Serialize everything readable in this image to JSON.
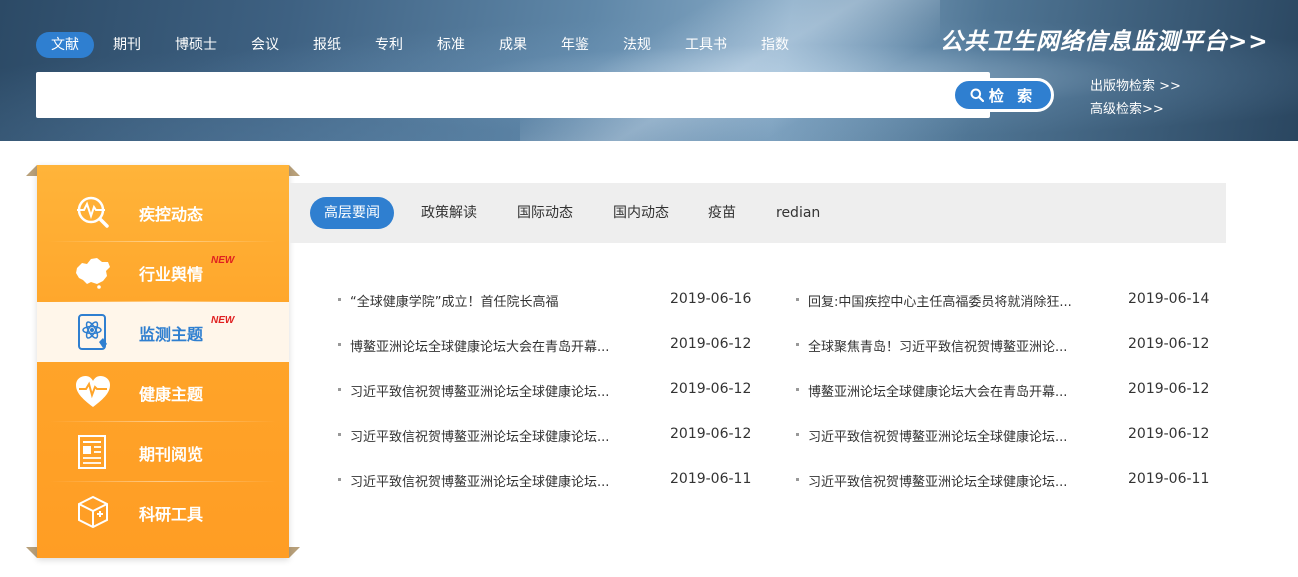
{
  "nav": {
    "items": [
      "文献",
      "期刊",
      "博硕士",
      "会议",
      "报纸",
      "专利",
      "标准",
      "成果",
      "年鉴",
      "法规",
      "工具书",
      "指数"
    ]
  },
  "search": {
    "placeholder": "",
    "value": "",
    "button_label": "检 索"
  },
  "platform_title": "公共卫生网络信息监测平台>>",
  "links": {
    "publication_search": "出版物检索 >>",
    "advanced_search": "高级检索>>"
  },
  "sidebar": {
    "items": [
      {
        "label": "疾控动态",
        "icon": "magnifier-heartbeat-icon",
        "badge": ""
      },
      {
        "label": "行业舆情",
        "icon": "china-map-icon",
        "badge": "NEW"
      },
      {
        "label": "监测主题",
        "icon": "tablet-atom-icon",
        "badge": "NEW"
      },
      {
        "label": "健康主题",
        "icon": "heart-pulse-icon",
        "badge": ""
      },
      {
        "label": "期刊阅览",
        "icon": "newspaper-icon",
        "badge": ""
      },
      {
        "label": "科研工具",
        "icon": "medical-box-icon",
        "badge": ""
      }
    ],
    "active_index": 2
  },
  "tabs": [
    "高层要闻",
    "政策解读",
    "国际动态",
    "国内动态",
    "疫苗",
    "redian"
  ],
  "active_tab": 0,
  "news_left": [
    {
      "title": "“全球健康学院”成立！首任院长高福",
      "date": "2019-06-16"
    },
    {
      "title": "博鳌亚洲论坛全球健康论坛大会在青岛开幕...",
      "date": "2019-06-12"
    },
    {
      "title": "习近平致信祝贺博鳌亚洲论坛全球健康论坛...",
      "date": "2019-06-12"
    },
    {
      "title": "习近平致信祝贺博鳌亚洲论坛全球健康论坛...",
      "date": "2019-06-12"
    },
    {
      "title": "习近平致信祝贺博鳌亚洲论坛全球健康论坛...",
      "date": "2019-06-11"
    }
  ],
  "news_right": [
    {
      "title": "回复:中国疾控中心主任高福委员将就消除狂...",
      "date": "2019-06-14"
    },
    {
      "title": "全球聚焦青岛！习近平致信祝贺博鳌亚洲论...",
      "date": "2019-06-12"
    },
    {
      "title": "博鳌亚洲论坛全球健康论坛大会在青岛开幕...",
      "date": "2019-06-12"
    },
    {
      "title": "习近平致信祝贺博鳌亚洲论坛全球健康论坛...",
      "date": "2019-06-12"
    },
    {
      "title": "习近平致信祝贺博鳌亚洲论坛全球健康论坛...",
      "date": "2019-06-11"
    }
  ],
  "colors": {
    "accent": "#2f7fd0",
    "sidebar": "#ffa52a",
    "badge": "#e02020"
  }
}
